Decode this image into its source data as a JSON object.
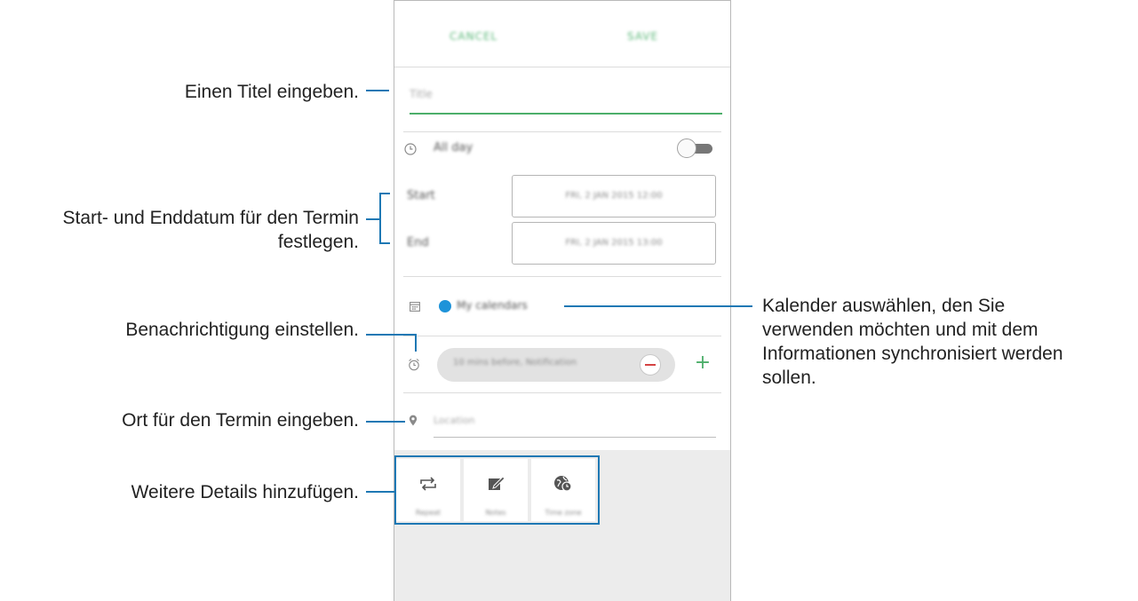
{
  "header": {
    "cancel_label": "CANCEL",
    "save_label": "SAVE"
  },
  "form": {
    "title_placeholder": "Title",
    "all_day_label": "All day",
    "all_day_on": false,
    "start_label": "Start",
    "start_value": "FRI, 2 JAN 2015   12:00",
    "end_label": "End",
    "end_value": "FRI, 2 JAN 2015   13:00",
    "calendar_label": "My calendars",
    "calendar_color": "#1e93d9",
    "reminder_value": "10 mins before, Notification",
    "location_placeholder": "Location"
  },
  "details": [
    {
      "label": "Repeat",
      "icon": "repeat-icon"
    },
    {
      "label": "Notes",
      "icon": "notes-icon"
    },
    {
      "label": "Time zone",
      "icon": "time-zone-icon"
    }
  ],
  "callouts": {
    "title": "Einen Titel eingeben.",
    "dates_line1": "Start- und Enddatum für den Termin",
    "dates_line2": "festlegen.",
    "notification": "Benachrichtigung einstellen.",
    "location": "Ort für den Termin eingeben.",
    "details": "Weitere Details hinzufügen.",
    "calendar_line1": "Kalender auswählen, den Sie",
    "calendar_line2": "verwenden möchten und mit dem",
    "calendar_line3": "Informationen synchronisiert werden",
    "calendar_line4": "sollen."
  },
  "colors": {
    "accent": "#4cae6a",
    "callout_line": "#1e78b4",
    "minus": "#d54343"
  }
}
